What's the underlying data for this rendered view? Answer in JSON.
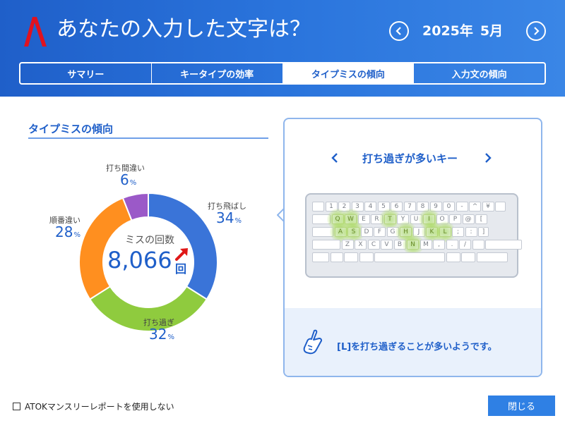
{
  "header": {
    "title": "あなたの入力した文字は？",
    "year": "2025年",
    "month": "5月",
    "prev_icon": "chevron-left-icon",
    "next_icon": "chevron-right-icon"
  },
  "tabs": [
    {
      "label": "サマリー",
      "active": false
    },
    {
      "label": "キータイプの効率",
      "active": false
    },
    {
      "label": "タイプミスの傾向",
      "active": true
    },
    {
      "label": "入力文の傾向",
      "active": false
    }
  ],
  "section": {
    "title": "タイプミスの傾向"
  },
  "chart_data": {
    "type": "pie",
    "center_label": "ミスの回数",
    "center_value": "8,066",
    "center_unit": "回",
    "trend": "up",
    "slices": [
      {
        "name": "打ち飛ばし",
        "value": 34,
        "color": "#3a74d8"
      },
      {
        "name": "打ち過ぎ",
        "value": 32,
        "color": "#8fcb3e"
      },
      {
        "name": "順番違い",
        "value": 28,
        "color": "#ff8f1f"
      },
      {
        "name": "打ち間違い",
        "value": 6,
        "color": "#9b59c8"
      }
    ],
    "unit": "%"
  },
  "keyboard_panel": {
    "title": "打ち過ぎが多いキー",
    "highlighted_keys": [
      "Q",
      "W",
      "T",
      "I",
      "A",
      "S",
      "H",
      "K",
      "L",
      "N"
    ],
    "rows": [
      [
        "",
        "1",
        "2",
        "3",
        "4",
        "5",
        "6",
        "7",
        "8",
        "9",
        "0",
        "-",
        "^",
        "¥",
        ""
      ],
      [
        "",
        "Q",
        "W",
        "E",
        "R",
        "T",
        "Y",
        "U",
        "I",
        "O",
        "P",
        "@",
        "["
      ],
      [
        "",
        "A",
        "S",
        "D",
        "F",
        "G",
        "H",
        "J",
        "K",
        "L",
        ";",
        ":",
        "]"
      ],
      [
        "",
        "Z",
        "X",
        "C",
        "V",
        "B",
        "N",
        "M",
        ",",
        ".",
        "/",
        "",
        ""
      ],
      [
        "",
        "",
        "",
        "",
        "",
        "",
        "",
        ""
      ]
    ],
    "hint": "[L]を打ち過ぎることが多いようです。"
  },
  "footer": {
    "checkbox_label": "ATOKマンスリーレポートを使用しない",
    "close_label": "閉じる"
  },
  "colors": {
    "accent": "#1f5fc9",
    "header_bg": "#2a74dc",
    "button": "#2f80e4"
  }
}
